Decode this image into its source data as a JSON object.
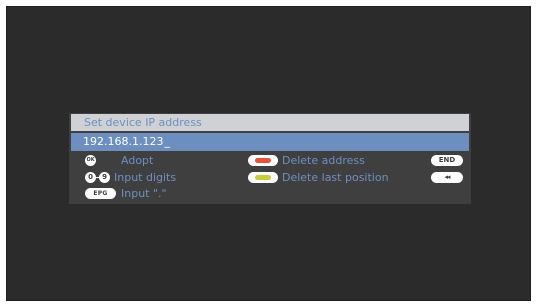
{
  "dialog": {
    "title": "Set device IP address",
    "ip_value": "192.168.1.123",
    "cursor": "_"
  },
  "legend": {
    "adopt": {
      "key": "OK",
      "label": "Adopt"
    },
    "input_digits": {
      "key_from": "0",
      "key_to": "9",
      "label": "Input digits"
    },
    "input_dot": {
      "key": "EPG",
      "label": "Input \".\""
    },
    "delete_address": {
      "label": "Delete address",
      "color": "#e8533a"
    },
    "delete_last_position": {
      "label": "Delete last position",
      "color": "#c9cc3c"
    },
    "end_key": "END",
    "rewind_key": "◂◂"
  },
  "colors": {
    "accent_blue": "#6d8fc0",
    "screen_bg": "#2b2b2b",
    "dialog_bg": "#3f3f3f",
    "title_bg": "#cfd1d4"
  }
}
